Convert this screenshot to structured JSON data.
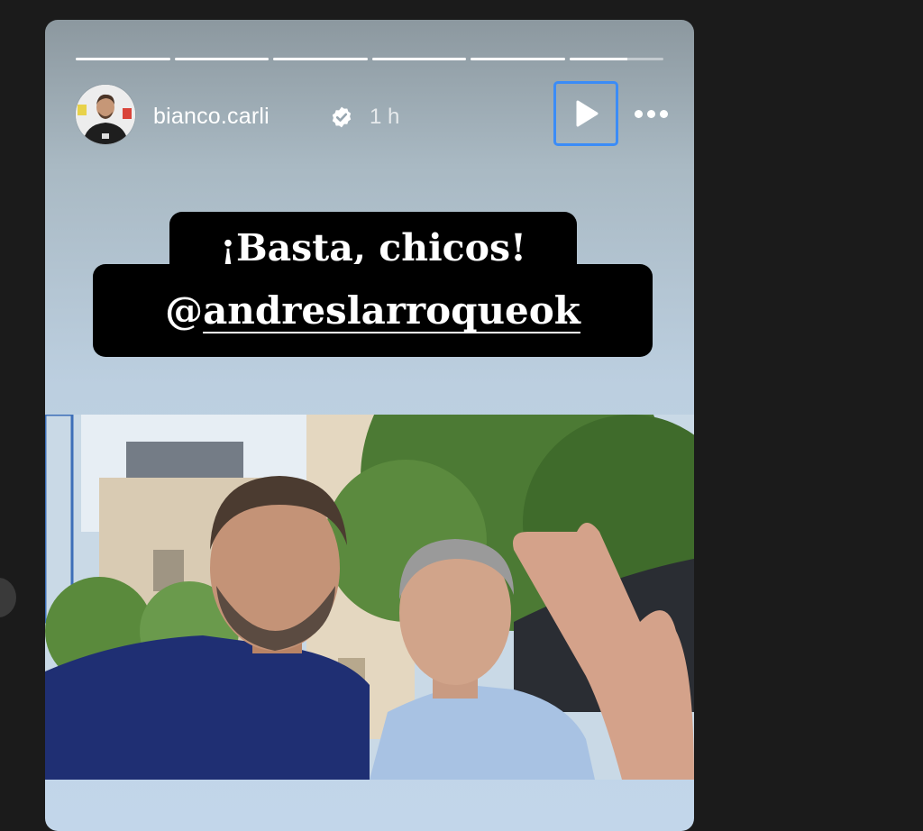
{
  "story": {
    "progress": [
      1,
      1,
      1,
      1,
      1,
      0.62
    ],
    "user": {
      "username": "bianco.carli",
      "verified": true,
      "time_ago": "1 h"
    },
    "controls": {
      "play_icon": "play-icon",
      "more_icon": "more-icon"
    },
    "caption": {
      "line1": "¡Basta, chicos!",
      "mention_prefix": "@",
      "mention": "andreslarroqueok"
    },
    "photo_description_icon": "selfie-photo"
  },
  "colors": {
    "play_focus_border": "#3b8cf7",
    "page_bg": "#1b1b1b"
  }
}
